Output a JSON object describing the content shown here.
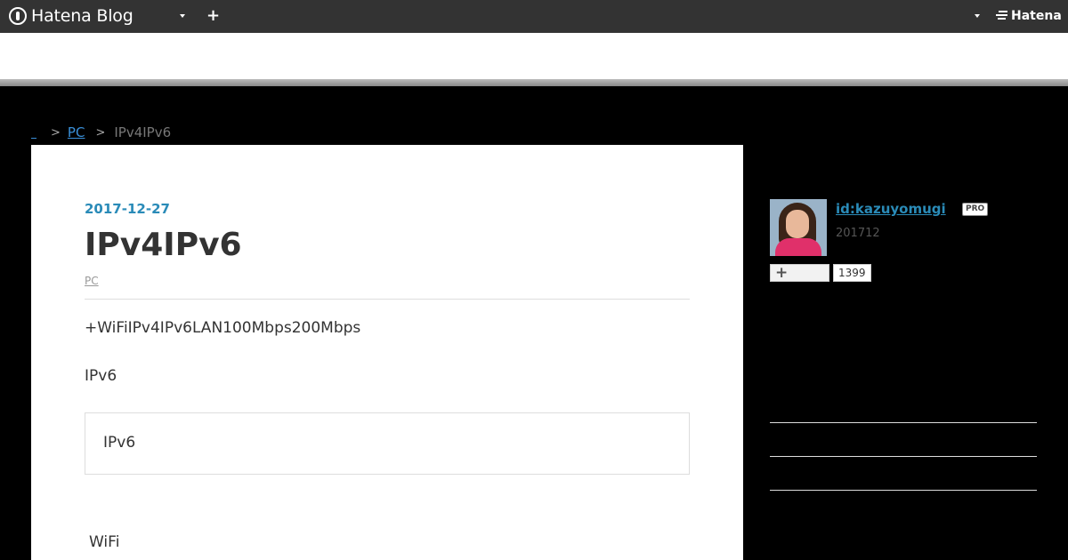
{
  "topbar": {
    "logo_text": "Hatena Blog",
    "add_label": "+",
    "brand_text": "Hatena"
  },
  "breadcrumb": {
    "category": "PC",
    "separator": ">",
    "current": "IPv4IPv6"
  },
  "article": {
    "date": "2017-12-27",
    "title": "IPv4IPv6",
    "category": "PC",
    "paragraph1": "+WiFiIPv4IPv6LAN100Mbps200Mbps",
    "paragraph2": "IPv6",
    "quote": "IPv6",
    "paragraph3": "WiFi"
  },
  "profile": {
    "username": "id:kazuyomugi",
    "badge": "PRO",
    "since": "201712",
    "follow_icon": "+",
    "follower_count": "1399"
  },
  "colors": {
    "topbar": "#333333",
    "link": "#2a8bb8",
    "background": "#000000"
  }
}
